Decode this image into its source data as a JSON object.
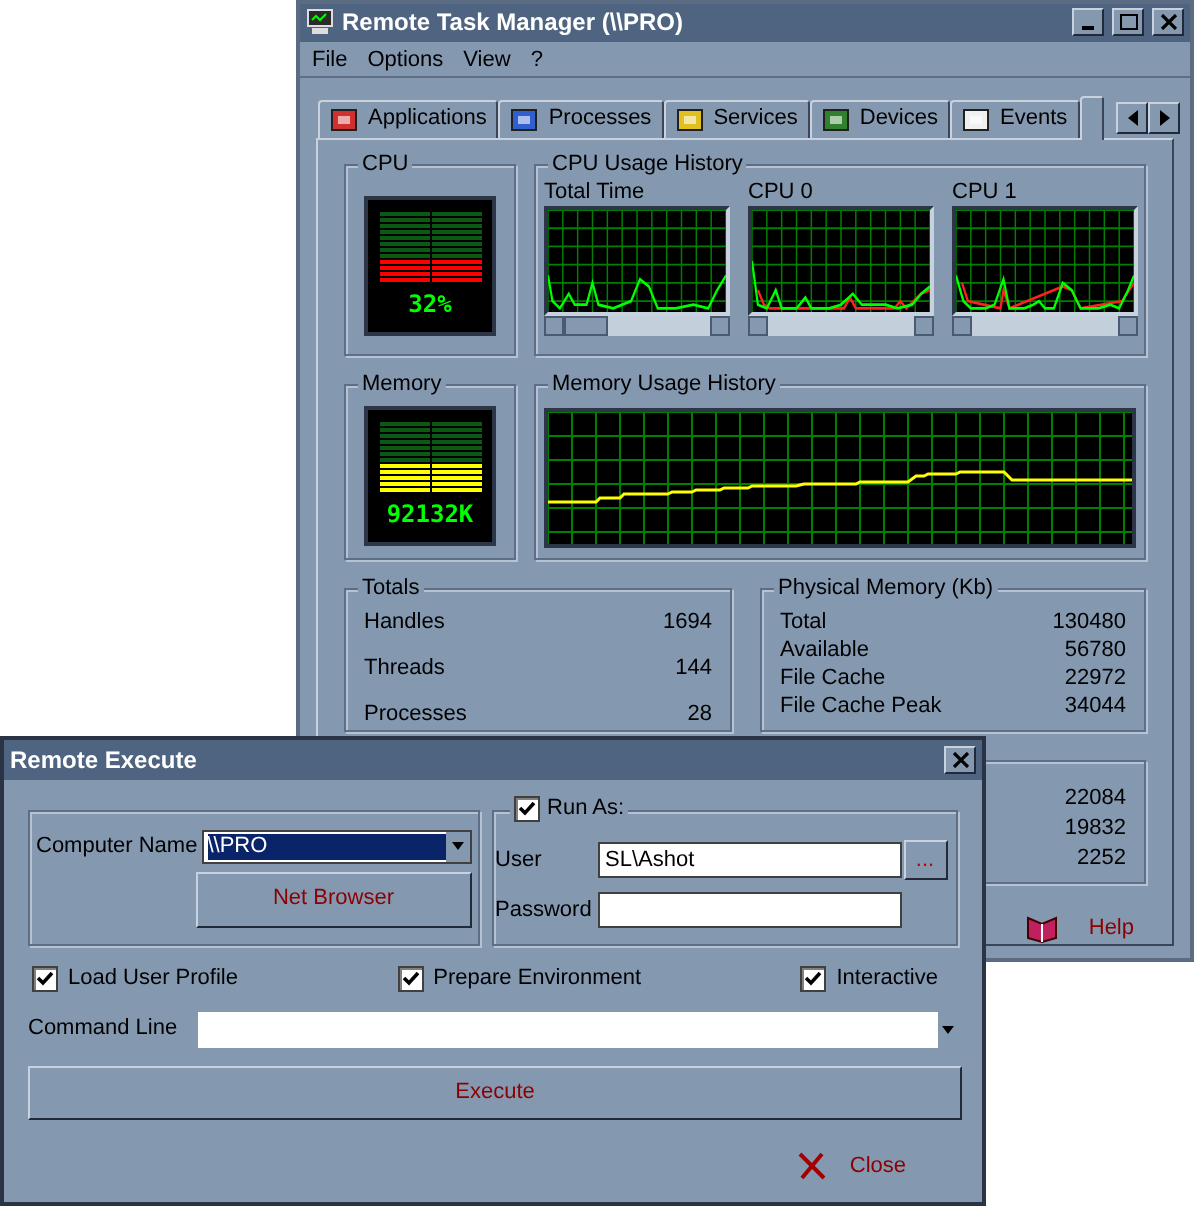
{
  "window": {
    "title": "Remote Task Manager (\\\\PRO)"
  },
  "menu": [
    "File",
    "Options",
    "View",
    "?"
  ],
  "tabs": [
    {
      "label": "Applications",
      "selected": false
    },
    {
      "label": "Processes",
      "selected": false
    },
    {
      "label": "Services",
      "selected": false
    },
    {
      "label": "Devices",
      "selected": false
    },
    {
      "label": "Events",
      "selected": false
    },
    {
      "selected": true
    }
  ],
  "cpu": {
    "title": "CPU",
    "reading": "32%",
    "level": 0.32
  },
  "cpu_history": {
    "title": "CPU Usage History",
    "graphs": [
      "Total Time",
      "CPU 0",
      "CPU 1"
    ]
  },
  "memory": {
    "title": "Memory",
    "reading": "92132K",
    "level": 0.45
  },
  "memory_history": {
    "title": "Memory Usage History"
  },
  "totals": {
    "title": "Totals",
    "rows": [
      {
        "label": "Handles",
        "value": "1694"
      },
      {
        "label": "Threads",
        "value": "144"
      },
      {
        "label": "Processes",
        "value": "28"
      }
    ]
  },
  "physical_memory": {
    "title": "Physical Memory (Kb)",
    "rows": [
      {
        "label": "Total",
        "value": "130480"
      },
      {
        "label": "Available",
        "value": "56780"
      },
      {
        "label": "File Cache",
        "value": "22972"
      },
      {
        "label": "File Cache Peak",
        "value": "34044"
      }
    ]
  },
  "group_4": {
    "values": [
      "22084",
      "19832",
      "2252"
    ]
  },
  "help_button": "Help",
  "dialog": {
    "title": "Remote Execute",
    "computer_name": {
      "label": "Computer Name",
      "value": "\\\\PRO"
    },
    "net_browser": "Net Browser",
    "run_as": {
      "label": "Run As:",
      "checked": true
    },
    "user": {
      "label": "User",
      "value": "SL\\Ashot"
    },
    "browse_button": "...",
    "password": {
      "label": "Password"
    },
    "options": [
      {
        "label": "Load User Profile",
        "checked": true
      },
      {
        "label": "Prepare Environment",
        "checked": true
      },
      {
        "label": "Interactive",
        "checked": true
      }
    ],
    "command_line": {
      "label": "Command Line"
    },
    "execute": "Execute",
    "close": "Close"
  }
}
